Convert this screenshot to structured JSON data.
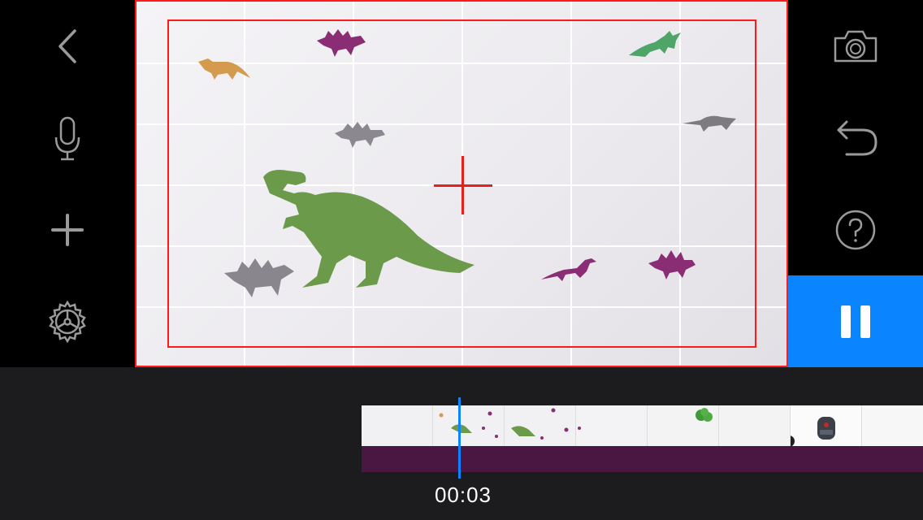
{
  "left_toolbar": {
    "items": [
      {
        "name": "back-button",
        "icon": "chevron-left-icon"
      },
      {
        "name": "microphone-button",
        "icon": "microphone-icon"
      },
      {
        "name": "add-button",
        "icon": "plus-icon"
      },
      {
        "name": "settings-button",
        "icon": "gear-icon"
      }
    ]
  },
  "right_toolbar": {
    "items": [
      {
        "name": "camera-button",
        "icon": "camera-icon"
      },
      {
        "name": "undo-button",
        "icon": "undo-icon"
      },
      {
        "name": "help-button",
        "icon": "help-icon"
      }
    ],
    "record_state": "paused-icon",
    "accent_color": "#0a84ff"
  },
  "viewer": {
    "overlay_color": "#ff1a1a",
    "grid": "on"
  },
  "timeline": {
    "timecode": "00:03",
    "playhead_color": "#0a84ff",
    "audio_track_color": "#4a1642"
  }
}
